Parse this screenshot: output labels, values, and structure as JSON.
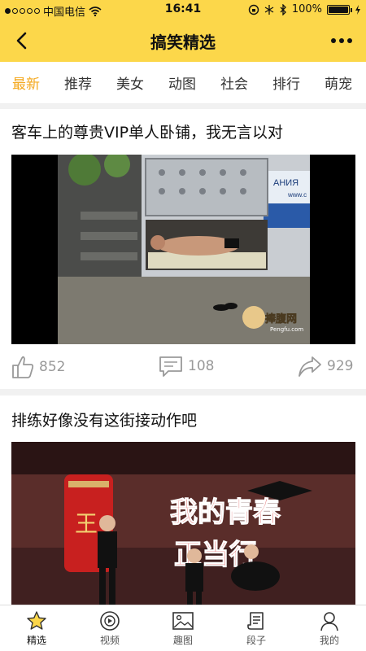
{
  "status_bar": {
    "carrier": "中国电信",
    "time": "16:41",
    "battery": "100%",
    "battery_level": 1.0
  },
  "nav": {
    "title": "搞笑精选"
  },
  "tabs": [
    {
      "label": "最新",
      "active": true
    },
    {
      "label": "推荐",
      "active": false
    },
    {
      "label": "美女",
      "active": false
    },
    {
      "label": "动图",
      "active": false
    },
    {
      "label": "社会",
      "active": false
    },
    {
      "label": "排行",
      "active": false
    },
    {
      "label": "萌宠",
      "active": false
    }
  ],
  "posts": [
    {
      "title": "客车上的尊贵VIP单人卧铺，我无言以对",
      "image_text_watermark": "捧腹网",
      "image_text_watermark_sub": "Pengfu.com",
      "image_text_bus": "АНИЯ",
      "image_text_bus_sub": "www.c",
      "likes": "852",
      "comments": "108",
      "shares": "929"
    },
    {
      "title": "排练好像没有这街接动作吧",
      "image_text_can": "王",
      "image_text_banner": "我的青春",
      "image_text_banner2": "正当行"
    }
  ],
  "tab_bar": [
    {
      "label": "精选",
      "icon": "star-icon",
      "active": true
    },
    {
      "label": "视频",
      "icon": "play-icon",
      "active": false
    },
    {
      "label": "趣图",
      "icon": "picture-icon",
      "active": false
    },
    {
      "label": "段子",
      "icon": "scroll-icon",
      "active": false
    },
    {
      "label": "我的",
      "icon": "person-icon",
      "active": false
    }
  ],
  "colors": {
    "accent": "#fcd74a",
    "active_tab": "#f4a81e",
    "muted": "#999999"
  }
}
